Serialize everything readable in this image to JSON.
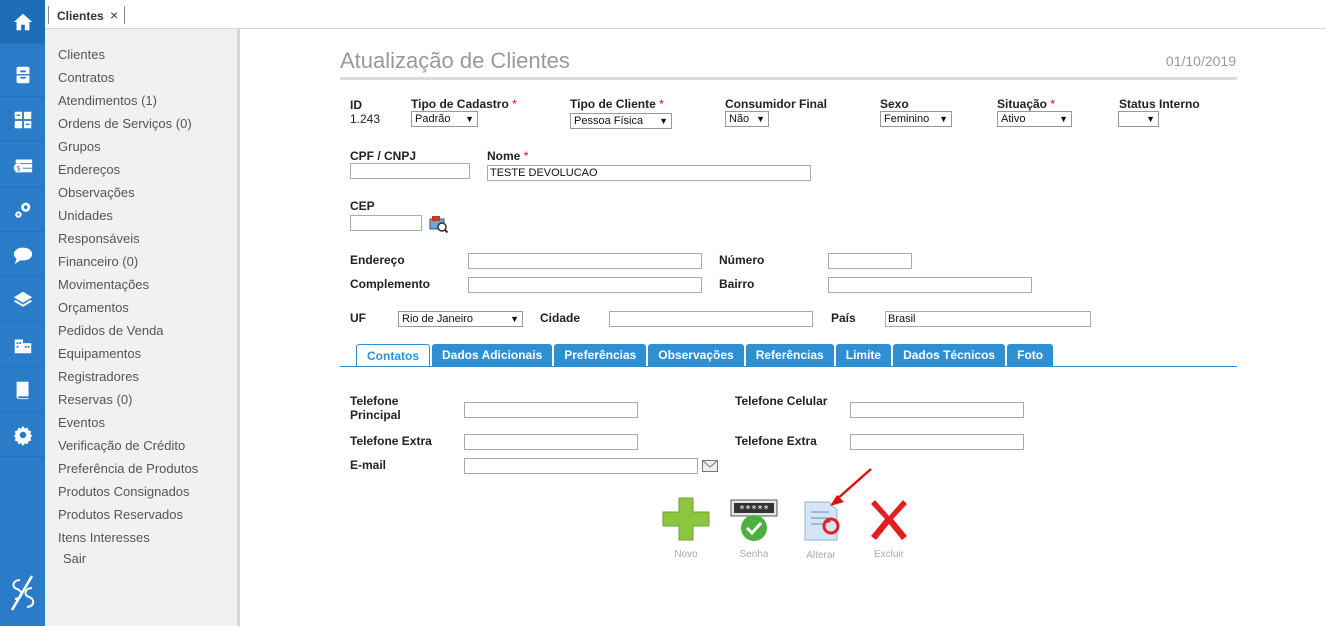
{
  "tabbar": {
    "tab_label": "Clientes",
    "tab_close": "×"
  },
  "menu": {
    "items": [
      "Clientes",
      "Contratos",
      "Atendimentos (1)",
      "Ordens de Serviços (0)",
      "Grupos",
      "Endereços",
      "Observações",
      "Unidades",
      "Responsáveis",
      "Financeiro (0)",
      "Movimentações",
      "Orçamentos",
      "Pedidos de Venda",
      "Equipamentos",
      "Registradores",
      "Reservas (0)",
      "Eventos",
      "Verificação de Crédito",
      "Preferência de Produtos",
      "Produtos Consignados",
      "Produtos Reservados",
      "Itens Interesses"
    ],
    "sair": "Sair"
  },
  "rail": {
    "icons": [
      "home-icon",
      "archive-icon",
      "calculator-icon",
      "money-icon",
      "gear-cluster-icon",
      "chat-icon",
      "layers-icon",
      "building-icon",
      "book-icon",
      "settings-icon"
    ]
  },
  "header": {
    "title": "Atualização de Clientes",
    "date": "01/10/2019"
  },
  "form": {
    "id_label": "ID",
    "id_value": "1.243",
    "tipo_cadastro_label": "Tipo de Cadastro",
    "tipo_cadastro_value": "Padrão",
    "tipo_cliente_label": "Tipo de Cliente",
    "tipo_cliente_value": "Pessoa Física",
    "consumidor_final_label": "Consumidor Final",
    "consumidor_final_value": "Não",
    "sexo_label": "Sexo",
    "sexo_value": "Feminino",
    "situacao_label": "Situação",
    "situacao_value": "Ativo",
    "status_interno_label": "Status Interno",
    "status_interno_value": "",
    "cpf_label": "CPF / CNPJ",
    "cpf_value": "",
    "nome_label": "Nome",
    "nome_value": "TESTE DEVOLUCAO",
    "cep_label": "CEP",
    "cep_value": "",
    "endereco_label": "Endereço",
    "endereco_value": "",
    "numero_label": "Número",
    "numero_value": "",
    "complemento_label": "Complemento",
    "complemento_value": "",
    "bairro_label": "Bairro",
    "bairro_value": "",
    "uf_label": "UF",
    "uf_value": "Rio de Janeiro",
    "cidade_label": "Cidade",
    "cidade_value": "",
    "pais_label": "País",
    "pais_value": "Brasil",
    "required_mark": "*"
  },
  "tabs": [
    "Contatos",
    "Dados Adicionais",
    "Preferências",
    "Observações",
    "Referências",
    "Limite",
    "Dados Técnicos",
    "Foto"
  ],
  "contatos": {
    "tel_principal_label": "Telefone Principal",
    "tel_celular_label": "Telefone Celular",
    "tel_extra_label": "Telefone Extra",
    "tel_extra2_label": "Telefone Extra",
    "email_label": "E-mail"
  },
  "actions": {
    "novo": "Novo",
    "senha": "Senha",
    "alterar": "Alterar",
    "excluir": "Excluir",
    "senha_mask": "*****"
  },
  "colors": {
    "rail": "#2a7bc8",
    "tab": "#2f8fd3",
    "required": "#dd0000",
    "annotation_arrow": "#dd1111"
  }
}
